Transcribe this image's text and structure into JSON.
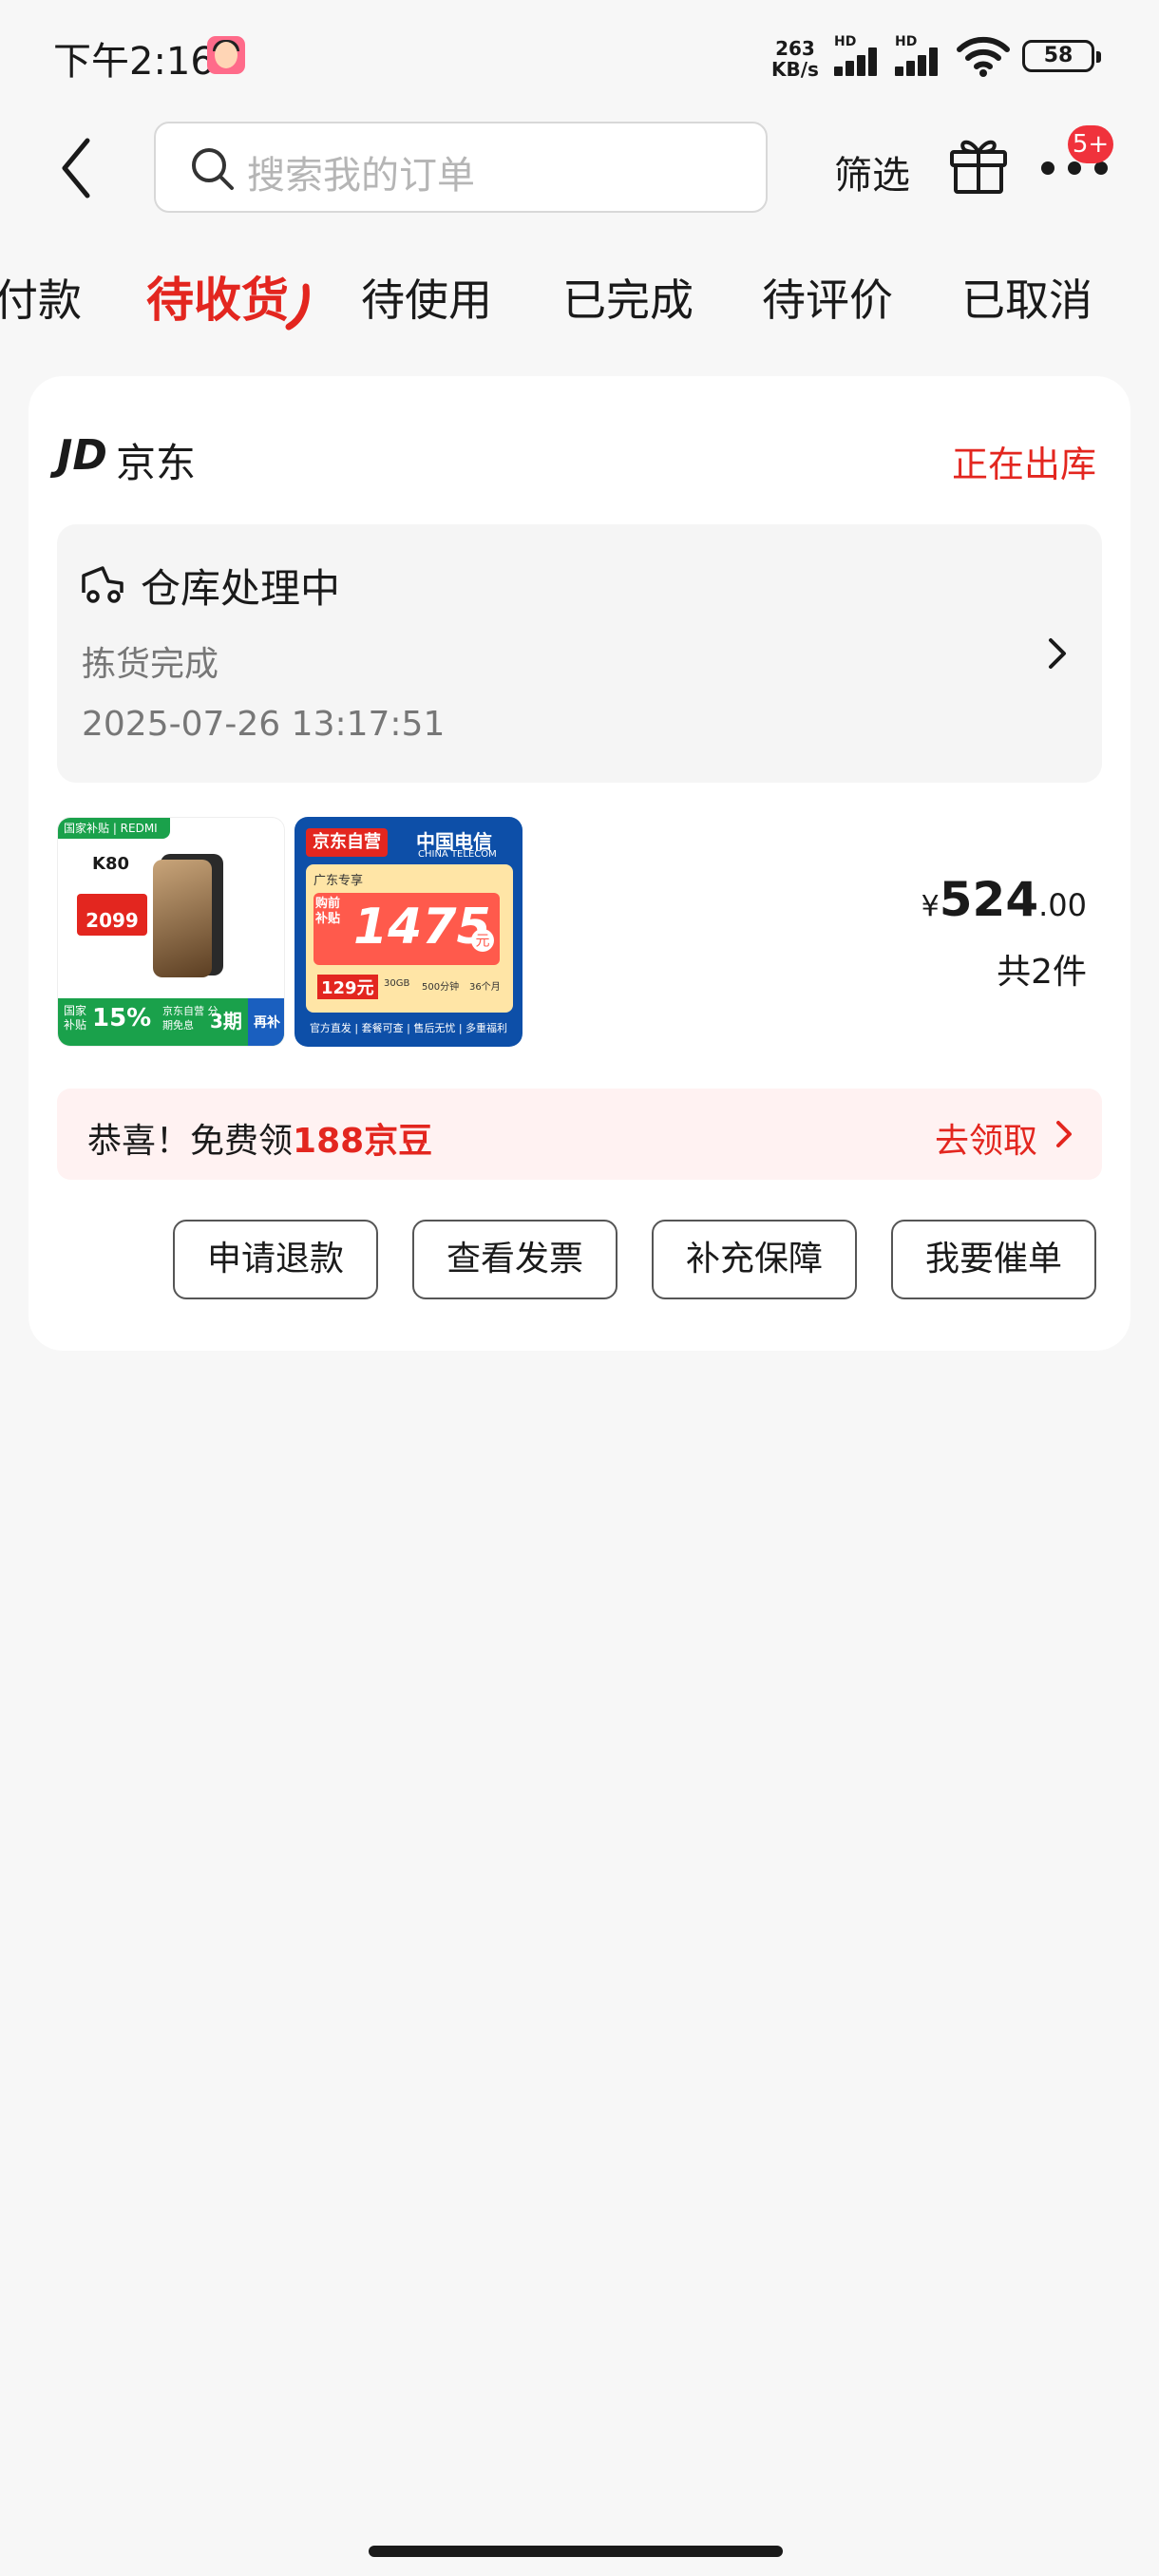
{
  "status_bar": {
    "time": "下午2:16",
    "speed_value": "263",
    "speed_unit": "KB/s",
    "hd_label": "HD",
    "battery": "58"
  },
  "header": {
    "search_placeholder": "搜索我的订单",
    "filter_label": "筛选",
    "notification_badge": "5+",
    "icons": [
      "back-arrow-icon",
      "search-icon",
      "gift-icon",
      "more-icon"
    ]
  },
  "tabs": [
    {
      "label": "付款",
      "active": false
    },
    {
      "label": "待收货",
      "active": true
    },
    {
      "label": "待使用",
      "active": false
    },
    {
      "label": "已完成",
      "active": false
    },
    {
      "label": "待评价",
      "active": false
    },
    {
      "label": "已取消",
      "active": false
    }
  ],
  "order": {
    "shop_logo": "JD",
    "shop_name": "京东",
    "status": "正在出库",
    "tracking": {
      "title": "仓库处理中",
      "detail": "拣货完成",
      "time": "2025-07-26 13:17:51"
    },
    "products": [
      {
        "tag": "国家补贴 | REDMI",
        "model": "K80",
        "price": "2099",
        "bottom_left": "国家补贴",
        "bottom_pct": "15%",
        "bottom_mid": "京东自营 分期免息",
        "bottom_num": "3期",
        "bottom_right": "再补"
      },
      {
        "tag": "京东自营",
        "brand": "中国电信",
        "brand_en": "CHINA TELECOM",
        "region": "广东专享",
        "corner": "购前补贴",
        "amount": "1475",
        "unit": "元",
        "monthly": "129元",
        "specs": [
          "30GB",
          "500分钟",
          "36个月"
        ],
        "footer": "官方直发 | 套餐可查 | 售后无忧 | 多重福利"
      }
    ],
    "price_currency": "¥",
    "price_int": "524",
    "price_dec": ".00",
    "quantity": "共2件",
    "promo": {
      "text": "恭喜！免费领",
      "highlight": "188京豆",
      "action": "去领取"
    },
    "buttons": [
      "申请退款",
      "查看发票",
      "补充保障",
      "我要催单"
    ]
  },
  "colors": {
    "accent": "#e3261f",
    "background": "#f7f7f7",
    "card": "#ffffff"
  }
}
